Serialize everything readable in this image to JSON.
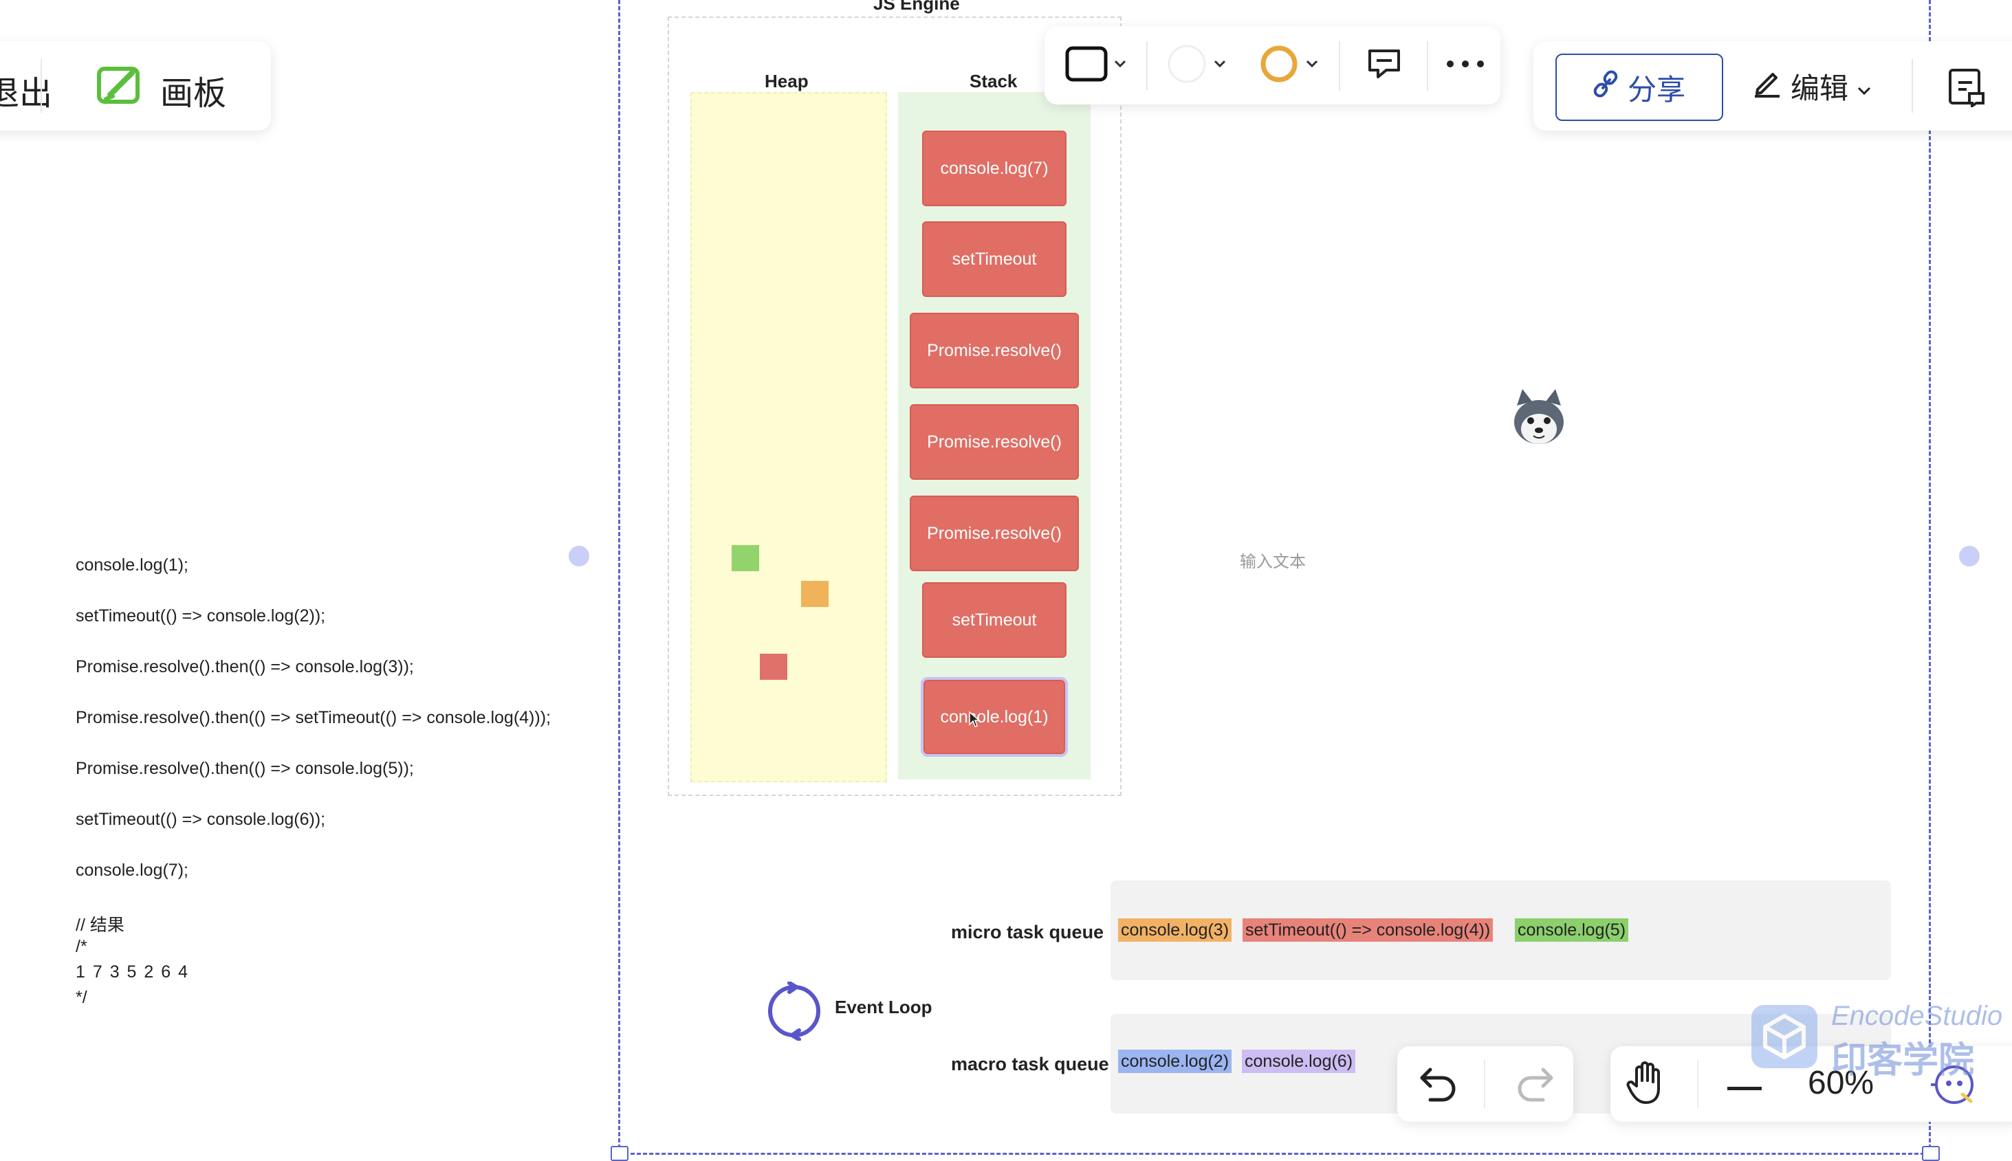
{
  "top_left": {
    "exit_label": "退出",
    "board_label": "画板"
  },
  "toolbar": {
    "shape_icon": "rectangle-icon",
    "fill_icon": "circle-fill-icon",
    "stroke_icon": "circle-stroke-icon",
    "comment_icon": "comment-icon",
    "more_icon": "more-icon",
    "accent_stroke_color": "#e8a73a"
  },
  "top_right": {
    "share_label": "分享",
    "edit_label": "编辑",
    "share_color": "#2d4ea7"
  },
  "engine": {
    "title": "JS Engine",
    "heap_title": "Heap",
    "stack_title": "Stack",
    "stack_items": [
      "console.log(7)",
      "setTimeout",
      "Promise.resolve()",
      "Promise.resolve()",
      "Promise.resolve()",
      "setTimeout",
      "console.log(1)"
    ]
  },
  "code": {
    "lines": [
      "console.log(1);",
      "setTimeout(() => console.log(2));",
      "Promise.resolve().then(() => console.log(3));",
      "Promise.resolve().then(() => setTimeout(() => console.log(4)));",
      "Promise.resolve().then(() => console.log(5));",
      "setTimeout(() => console.log(6));",
      "console.log(7);"
    ],
    "comment_title": "// 结果",
    "comment_open": "/*",
    "result": "1 7 3 5 2 6 4",
    "comment_close": "*/"
  },
  "canvas": {
    "text_placeholder": "输入文本"
  },
  "queues": {
    "micro_label": "micro task queue",
    "macro_label": "macro task queue",
    "micro_items": [
      {
        "text": "console.log(3)",
        "color": "#f2b266"
      },
      {
        "text": "setTimeout(() => console.log(4))",
        "color": "#e8837a"
      },
      {
        "text": "console.log(5)",
        "color": "#8ccf6d"
      }
    ],
    "macro_items": [
      {
        "text": "console.log(2)",
        "color": "#9bb5f0"
      },
      {
        "text": "console.log(6)",
        "color": "#cdbdf3"
      }
    ]
  },
  "event_loop": {
    "label": "Event Loop"
  },
  "bottom_controls": {
    "undo_icon": "undo-icon",
    "redo_icon": "redo-icon",
    "hand_icon": "hand-icon",
    "zoom_out_icon": "minus-icon",
    "zoom_level": "60%"
  },
  "watermark": {
    "line1": "EncodeStudio",
    "line2": "印客学院"
  }
}
